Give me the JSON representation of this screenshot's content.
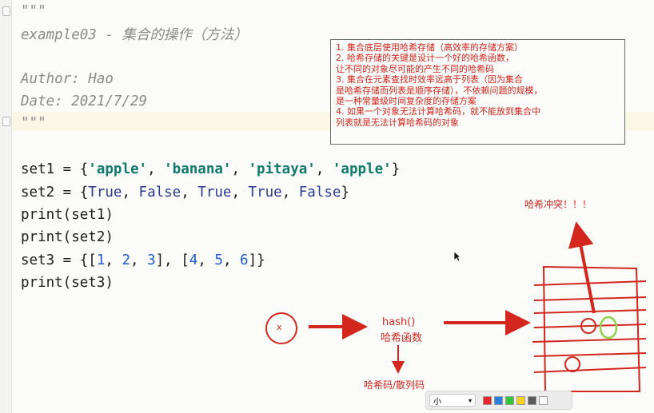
{
  "code": {
    "docstring_open": "\"\"\"",
    "docstring_title": "example03 - 集合的操作（方法）",
    "author": "Author: Hao",
    "date": "Date: 2021/7/29",
    "docstring_close": "\"\"\"",
    "line_set1": {
      "prefix": "set1 = {",
      "s1": "'apple'",
      "c1": ", ",
      "s2": "'banana'",
      "c2": ", ",
      "s3": "'pitaya'",
      "c3": ", ",
      "s4": "'apple'",
      "suffix": "}"
    },
    "line_set2": {
      "prefix": "set2 = {",
      "v1": "True",
      "c1": ", ",
      "v2": "False",
      "c2": ", ",
      "v3": "True",
      "c3": ", ",
      "v4": "True",
      "c4": ", ",
      "v5": "False",
      "suffix": "}"
    },
    "line_print1": "print(set1)",
    "line_print2": "print(set2)",
    "line_set3": {
      "prefix": "set3 = {[",
      "n1": "1",
      "c1": ", ",
      "n2": "2",
      "c2": ", ",
      "n3": "3",
      "mid": "], [",
      "n4": "4",
      "c4": ", ",
      "n5": "5",
      "c5": ", ",
      "n6": "6",
      "suffix": "]}"
    },
    "line_print3": "print(set3)"
  },
  "notes": [
    "1. 集合底层使用哈希存储（高效率的存储方案）",
    "2. 哈希存储的关键是设计一个好的哈希函数，",
    "让不同的对象尽可能的产生不同的哈希码",
    "3. 集合在元素查找时效率远高于列表（因为集合",
    "是哈希存储而列表是顺序存储），不依赖问题的规模，",
    "是一种常量级时间复杂度的存储方案",
    "4. 如果一个对象无法计算哈希码，就不能放到集合中",
    "列表就是无法计算哈希码的对象"
  ],
  "diagram": {
    "x_label": "x",
    "hash_fn": "hash()",
    "hash_fn_cn": "哈希函数",
    "hash_code": "哈希码/散列码",
    "collision": "哈希冲突！！！"
  },
  "toolbar": {
    "size_value": "小",
    "colors": [
      "#e8262a",
      "#2a7de1",
      "#35c73a",
      "#f6d21d",
      "#5b5b5b",
      "#ffffff"
    ]
  }
}
